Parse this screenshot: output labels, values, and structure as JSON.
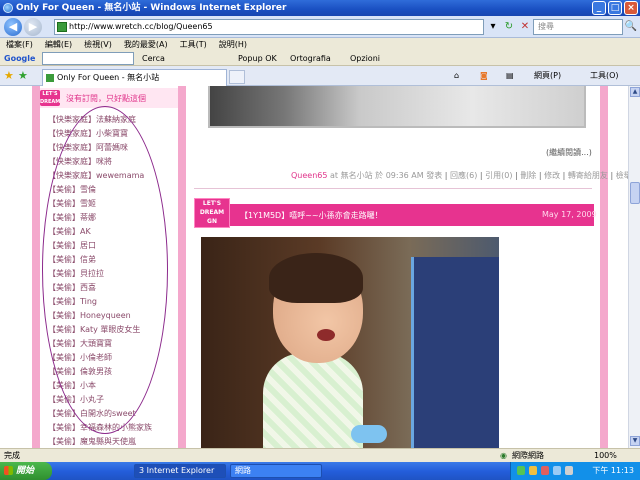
{
  "window": {
    "title": "Only For Queen - 無名小站 - Windows Internet Explorer"
  },
  "address": {
    "url": "http://www.wretch.cc/blog/Queen65",
    "search_placeholder": "搜尋"
  },
  "menu": [
    "檔案(F)",
    "編輯(E)",
    "檢視(V)",
    "我的最愛(A)",
    "工具(T)",
    "說明(H)"
  ],
  "google_toolbar": {
    "logo": "Google",
    "items": [
      "Cerca",
      "Popup OK",
      "Ortografia",
      "Opzioni"
    ]
  },
  "tabs": {
    "active": "Only For Queen - 無名小站"
  },
  "commands": {
    "page": "網頁(P)",
    "tools": "工具(O)"
  },
  "sidebar": {
    "header": "沒有訂閱，只好點這個",
    "logo": "LET'S DREAM",
    "links": [
      "【快樂家庭】法蘇納家庭",
      "【快樂家庭】小柴寶寶",
      "【快樂家庭】阿蕾媽咪",
      "【快樂家庭】咪將",
      "【快樂家庭】wewemama",
      "【美偷】雪倫",
      "【美偷】雪姬",
      "【美偷】蒂娜",
      "【美偷】AK",
      "【美偷】居口",
      "【美偷】信弟",
      "【美偷】貝拉拉",
      "【美偷】西喜",
      "【美偷】Ting",
      "【美偷】Honeyqueen",
      "【美偷】Katy 單眼皮女生",
      "【美偷】大頭寶寶",
      "【美偷】小倫老師",
      "【美偷】倫敦男孩",
      "【美偷】小本",
      "【美偷】小丸子",
      "【美偷】白開水的sweet",
      "【美偷】幸福森林的小熊家族",
      "【美偷】魔鬼縣與天使嵐"
    ]
  },
  "post_prev": {
    "read_more": "(繼續閱讀...)"
  },
  "meta": {
    "author": "Queen65",
    "at": "at",
    "site": "無名小站",
    "time": "於 09:36 AM 發表",
    "replies": "回應(6)",
    "trackback": "引用(0)",
    "delete": "刪除",
    "edit": "修改",
    "forward": "轉寄給朋友",
    "report": "檢舉"
  },
  "post": {
    "logo": "LET'S DREAM GN",
    "title": "【1Y1M5D】嘻呼~~小孫亦會走路囉！",
    "date": "May 17, 2009"
  },
  "status": {
    "left": "完成",
    "zone": "網際網路",
    "zoom": "100%"
  },
  "taskbar": {
    "start": "開始",
    "buttons": [
      "3 Internet Explorer",
      "網路"
    ],
    "clock": "下午 11:13"
  }
}
